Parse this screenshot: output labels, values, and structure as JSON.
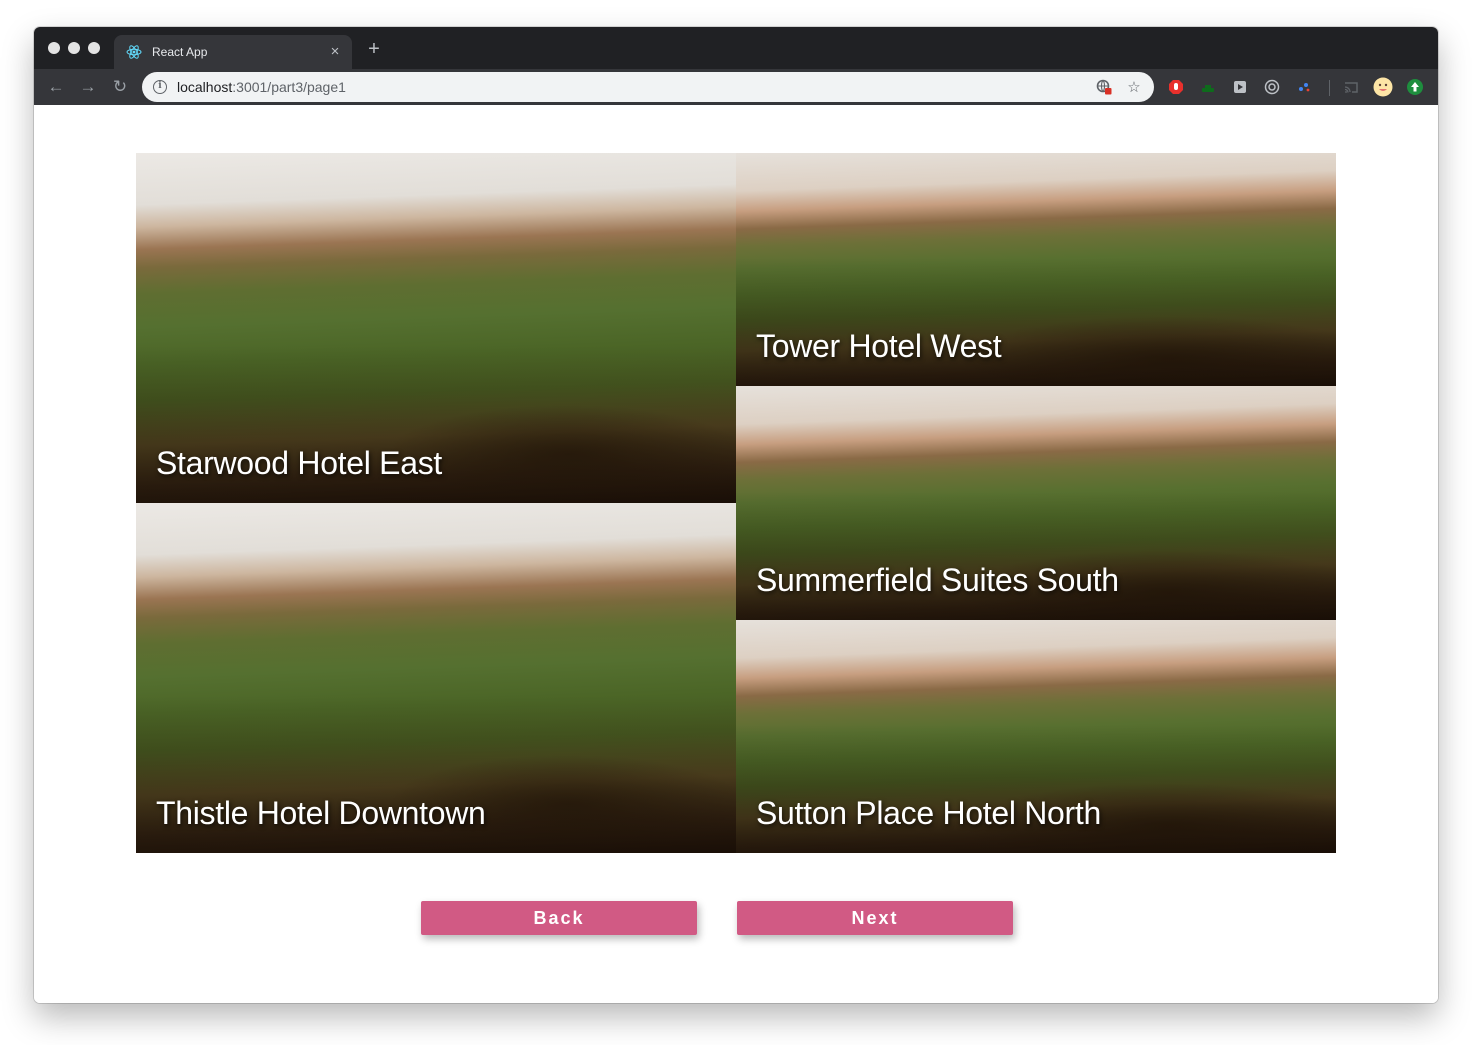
{
  "browser": {
    "tab_title": "React App",
    "tab_close": "×",
    "new_tab": "+",
    "url_host": "localhost",
    "url_path": ":3001/part3/page1",
    "icons": {
      "back": "←",
      "forward": "→",
      "reload": "↻",
      "info": "i",
      "bookmark": "☆"
    }
  },
  "hotels": [
    {
      "name": "Starwood Hotel East"
    },
    {
      "name": "Tower Hotel West"
    },
    {
      "name": "Summerfield Suites South"
    },
    {
      "name": "Thistle Hotel Downtown"
    },
    {
      "name": "Sutton Place Hotel North"
    }
  ],
  "buttons": {
    "back": "Back",
    "next": "Next"
  },
  "colors": {
    "button": "#d15a84",
    "browser_dark": "#202124"
  }
}
